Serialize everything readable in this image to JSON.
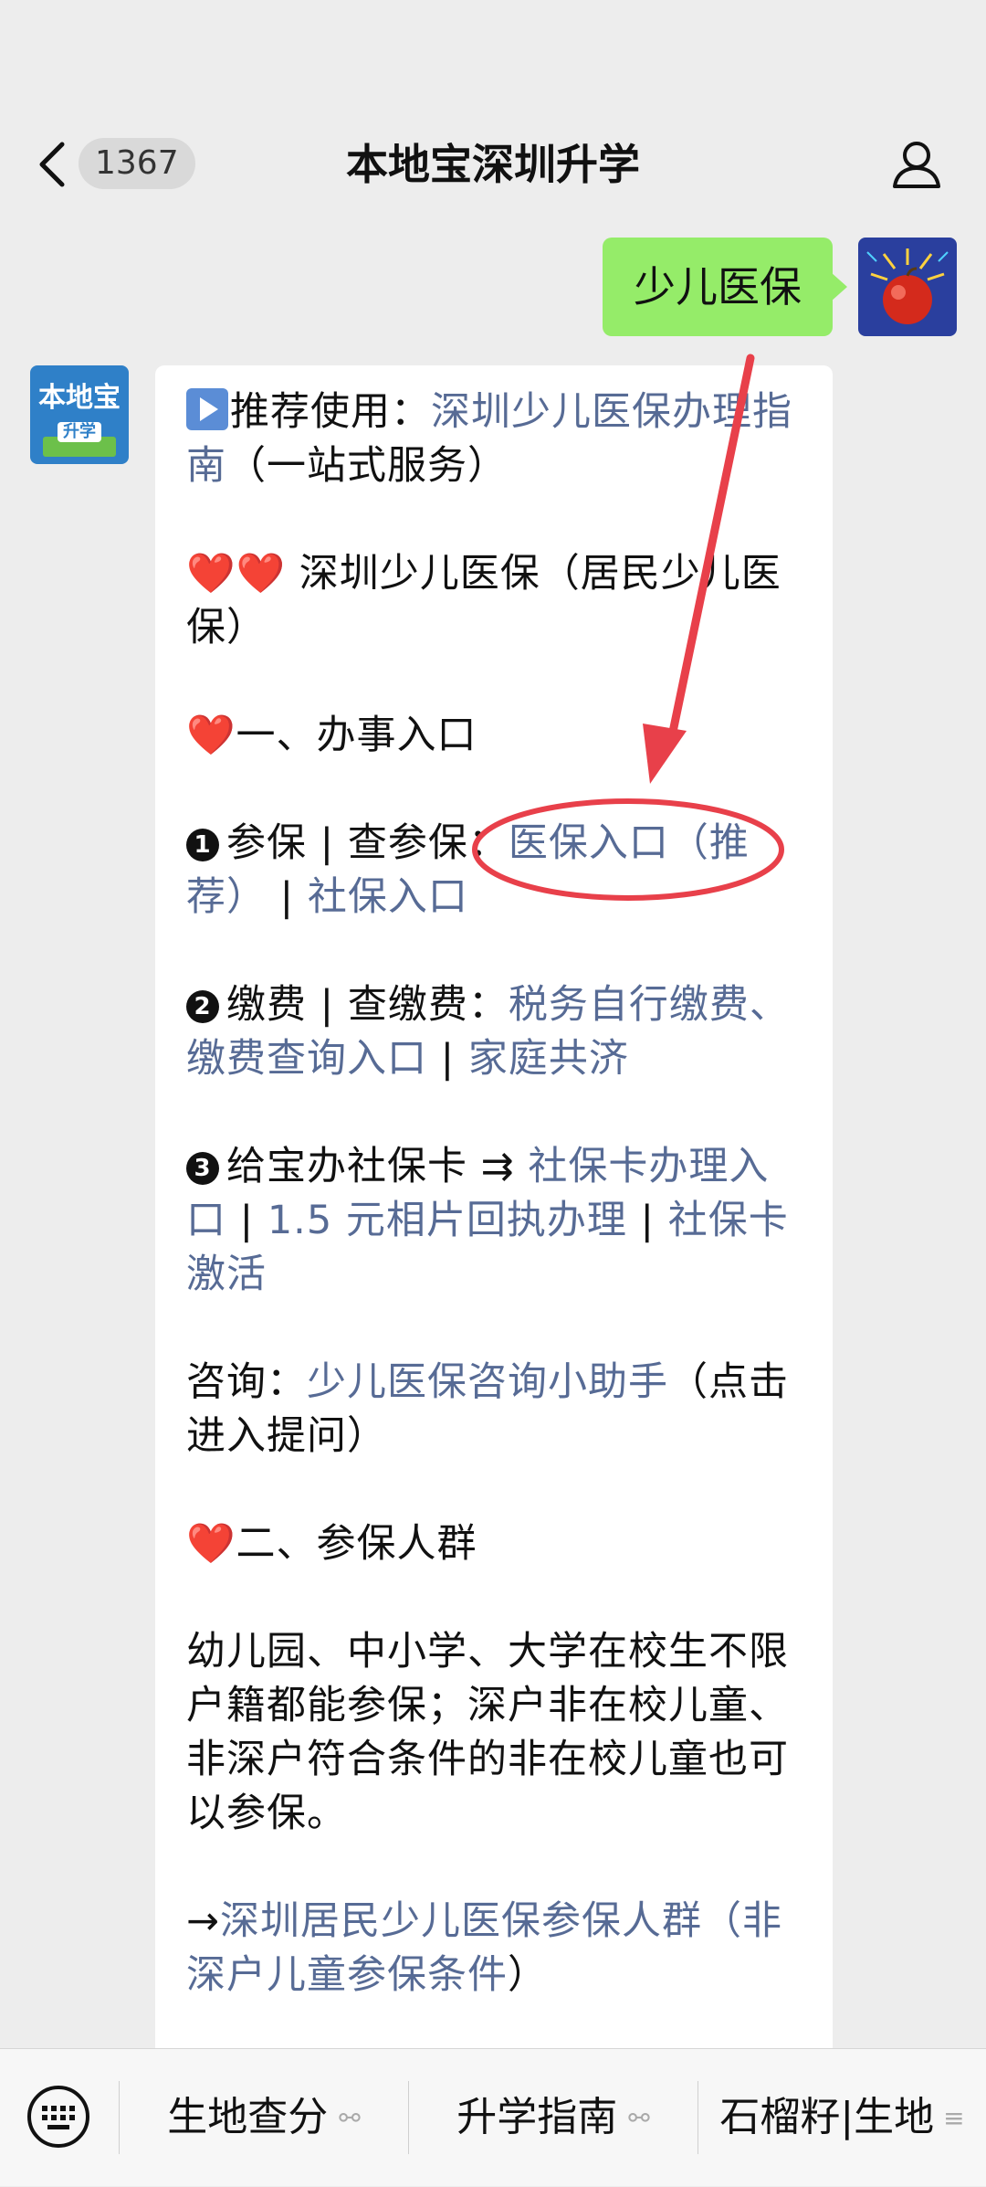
{
  "header": {
    "back_count": "1367",
    "title": "本地宝深圳升学"
  },
  "outgoing": {
    "text": "少儿医保"
  },
  "bot": {
    "avatar_line1": "本地宝",
    "avatar_line2": "升学",
    "recommend_prefix": "推荐使用：",
    "recommend_link": "深圳少儿医保办理指南",
    "recommend_suffix": "（一站式服务）",
    "hearts": "❤️❤️",
    "topic_title": " 深圳少儿医保（居民少儿医保）",
    "section1_heading": "一、办事入口",
    "item1_num": "1",
    "item1_label": "参保 | 查参保：",
    "item1_link_a": "医保入口（推荐）",
    "item1_sep": " | ",
    "item1_link_b": "社保入口",
    "item2_num": "2",
    "item2_label": "缴费 | 查缴费：",
    "item2_link_a": "税务自行缴费、缴费查询入口",
    "item2_sep": " | ",
    "item2_link_b": "家庭共济",
    "item3_num": "3",
    "item3_label": "给宝办社保卡 ⇉ ",
    "item3_link_a": "社保卡办理入口",
    "item3_sep1": " | ",
    "item3_link_b": "1.5 元相片回执办理",
    "item3_sep2": " | ",
    "item3_link_c": "社保卡激活",
    "consult_label": "咨询：",
    "consult_link": "少儿医保咨询小助手",
    "consult_suffix": "（点击进入提问）",
    "section2_heading": "二、参保人群",
    "population_text": "幼儿园、中小学、大学在校生不限户籍都能参保；深户非在校儿童、非深户符合条件的非在校儿童也可以参保。",
    "arrow": "→",
    "population_link_a": "深圳居民少儿医保参保人群",
    "population_link_b": "（非深户儿童参保条件",
    "population_suffix": "）"
  },
  "bottom_menu": {
    "item1": "生地查分",
    "item2": "升学指南",
    "item3": "石榴籽|生地"
  },
  "colors": {
    "link": "#576b95",
    "bubble_out": "#95ec69",
    "annotation": "#e8404a"
  }
}
